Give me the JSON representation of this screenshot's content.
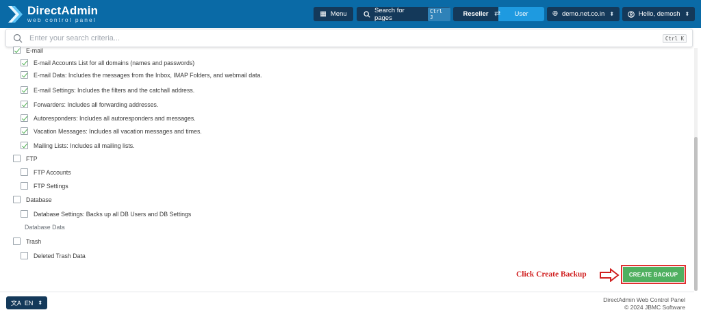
{
  "header": {
    "logo_name": "DirectAdmin",
    "logo_sub": "web control panel",
    "menu_label": "Menu",
    "search_pages_label": "Search for pages",
    "search_pages_shortcut": "Ctrl J",
    "role_reseller": "Reseller",
    "role_user": "User",
    "domain": "demo.net.co.in",
    "greeting": "Hello, demosh"
  },
  "search": {
    "placeholder": "Enter your search criteria...",
    "shortcut": "Ctrl K"
  },
  "options": {
    "email": {
      "label": "E-mail",
      "checked": true
    },
    "email_accounts": {
      "label": "E-mail Accounts List for all domains (names and passwords)",
      "checked": true
    },
    "email_data": {
      "label": "E-mail Data: Includes the messages from the Inbox, IMAP Folders, and webmail data.",
      "checked": true
    },
    "email_settings": {
      "label": "E-mail Settings: Includes the filters and the catchall address.",
      "checked": true
    },
    "forwarders": {
      "label": "Forwarders: Includes all forwarding addresses.",
      "checked": true
    },
    "autoresponders": {
      "label": "Autoresponders: Includes all autoresponders and messages.",
      "checked": true
    },
    "vacation": {
      "label": "Vacation Messages: Includes all vacation messages and times.",
      "checked": true
    },
    "mailing_lists": {
      "label": "Mailing Lists: Includes all mailing lists.",
      "checked": true
    },
    "ftp": {
      "label": "FTP",
      "checked": false
    },
    "ftp_accounts": {
      "label": "FTP Accounts",
      "checked": false
    },
    "ftp_settings": {
      "label": "FTP Settings",
      "checked": false
    },
    "database": {
      "label": "Database",
      "checked": false
    },
    "db_settings": {
      "label": "Database Settings: Backs up all DB Users and DB Settings",
      "checked": false
    },
    "db_data": {
      "label": "Database Data"
    },
    "trash": {
      "label": "Trash",
      "checked": false
    },
    "deleted_trash": {
      "label": "Deleted Trash Data",
      "checked": false
    }
  },
  "annotation": {
    "text": "Click Create Backup",
    "color": "#d01f1f"
  },
  "create_button": {
    "label": "CREATE BACKUP",
    "color": "#4fb060"
  },
  "footer": {
    "language": "EN",
    "line1": "DirectAdmin Web Control Panel",
    "line2": "© 2024 JBMC Software"
  },
  "colors": {
    "topbar": "#0a6aa6",
    "button_dark": "#14395a",
    "active_role": "#1e9ae0"
  }
}
